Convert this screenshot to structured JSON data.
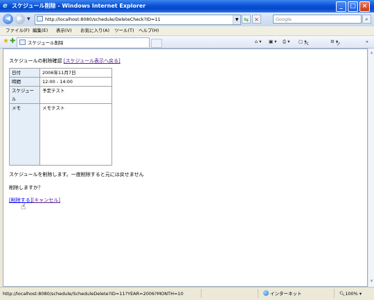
{
  "window": {
    "title": "スケジュール削除 - Windows Internet Explorer",
    "minimize": "_",
    "maximize": "□",
    "close": "×"
  },
  "address": {
    "url": "http://localhost:8080/schedule/DeleteCheck?ID=11",
    "search_placeholder": "Google"
  },
  "menu": {
    "items": [
      "ファイル(F)",
      "編集(E)",
      "表示(V)",
      "お気に入り(A)",
      "ツール(T)",
      "ヘルプ(H)"
    ]
  },
  "tab": {
    "label": "スケジュール削除"
  },
  "toolbar": {
    "page_label": "ページ(P)",
    "tools_label": "ツール(O)"
  },
  "page": {
    "heading_prefix": "スケジュールの削除確認",
    "heading_link": "[スケジュール表示へ戻る]",
    "rows": [
      {
        "label": "日付",
        "value": "2006年11月7日"
      },
      {
        "label": "時間",
        "value": "12:00 - 14:00"
      },
      {
        "label": "スケジュール",
        "value": "予定テスト"
      },
      {
        "label": "メモ",
        "value": "メモテスト"
      }
    ],
    "message1": "スケジュールを削除します。一度削除すると元には戻せません",
    "message2": "削除しますか？",
    "delete_link": "[削除する]",
    "cancel_link": "[キャンセル]"
  },
  "status": {
    "url": "http://localhost:8080/schedule/ScheduleDelete?ID=11?YEAR=2006?MONTH=10",
    "zone": "インターネット",
    "zoom": "100%"
  }
}
